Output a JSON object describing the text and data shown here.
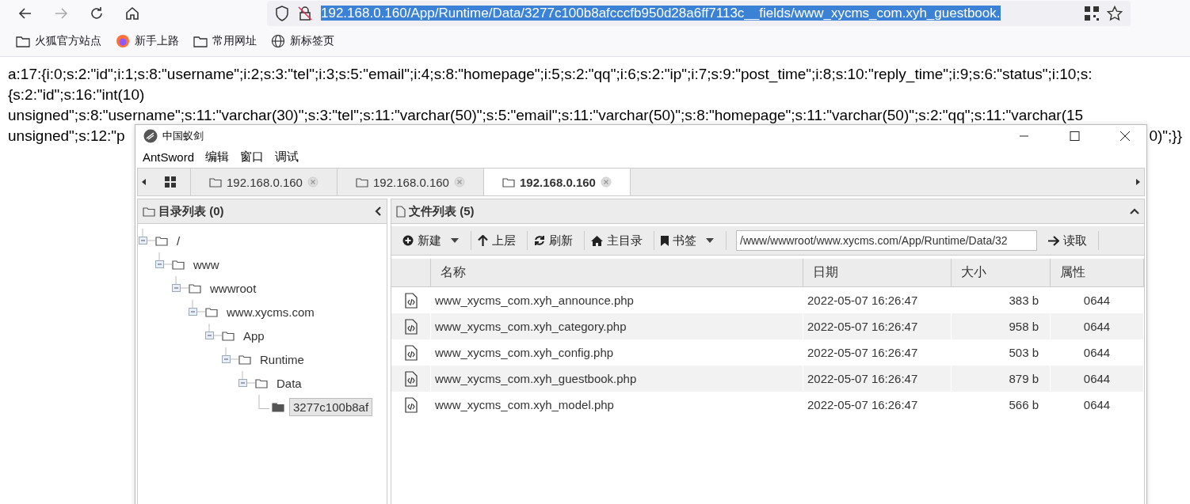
{
  "browser": {
    "url": {
      "text": "192.168.0.160/App/Runtime/Data/3277c100b8afcccfb950d28a6ff7113c__fields/www_xycms_com.xyh_guestbook.",
      "selected": true
    },
    "bookmarks": [
      {
        "label": "火狐官方站点",
        "kind": "folder"
      },
      {
        "label": "新手上路",
        "kind": "browser"
      },
      {
        "label": "常用网址",
        "kind": "folder"
      },
      {
        "label": "新标签页",
        "kind": "globe"
      }
    ]
  },
  "page_lines": [
    {
      "left": "a:17:{i:0;s:2:\"id\";i:1;s:8:\"username\";i:2;s:3:\"tel\";i:3;s:5:\"email\";i:4;s:8:\"homepage\";i:5;s:2:\"qq\";i:6;s:2:\"ip\";i:7;s:9:\"post_time\";i:8;s:10:\"reply_time\";i:9;s:6:\"status\";i:10;s:"
    },
    {
      "left": "{s:2:\"id\";s:16:\"int(10)"
    },
    {
      "left": "unsigned\";s:8:\"username\";s:11:\"varchar(30)\";s:3:\"tel\";s:11:\"varchar(50)\";s:5:\"email\";s:11:\"varchar(50)\";s:8:\"homepage\";s:11:\"varchar(50)\";s:2:\"qq\";s:11:\"varchar(15"
    },
    {
      "left": "unsigned\";s:12:\"p",
      "right": "0)\";}}"
    }
  ],
  "window": {
    "title": "中国蚁剑",
    "menu": [
      "AntSword",
      "编辑",
      "窗口",
      "调试"
    ],
    "tabs": [
      {
        "kind": "home",
        "selected": false
      },
      {
        "kind": "host",
        "label": "192.168.0.160",
        "selected": false
      },
      {
        "kind": "host",
        "label": "192.168.0.160",
        "selected": false
      },
      {
        "kind": "host",
        "label": "192.168.0.160",
        "selected": true
      }
    ],
    "dir_panel": {
      "title": "目录列表 (0)",
      "tree": [
        {
          "label": "/",
          "expanded": true,
          "selected": false,
          "children": [
            {
              "label": "www",
              "expanded": true,
              "selected": false,
              "children": [
                {
                  "label": "wwwroot",
                  "expanded": true,
                  "selected": false,
                  "children": [
                    {
                      "label": "www.xycms.com",
                      "expanded": true,
                      "selected": false,
                      "children": [
                        {
                          "label": "App",
                          "expanded": true,
                          "selected": false,
                          "children": [
                            {
                              "label": "Runtime",
                              "expanded": true,
                              "selected": false,
                              "children": [
                                {
                                  "label": "Data",
                                  "expanded": true,
                                  "selected": false,
                                  "children": [
                                    {
                                      "label": "3277c100b8af",
                                      "expanded": false,
                                      "selected": true
                                    }
                                  ]
                                }
                              ]
                            }
                          ]
                        }
                      ]
                    }
                  ]
                }
              ]
            }
          ]
        }
      ]
    },
    "file_panel": {
      "title": "文件列表 (5)",
      "toolbar": [
        {
          "label": "新建",
          "kind": "new",
          "dropdown": true
        },
        {
          "label": "上层",
          "kind": "up",
          "dropdown": false
        },
        {
          "label": "刷新",
          "kind": "refresh",
          "dropdown": false
        },
        {
          "label": "主目录",
          "kind": "home",
          "dropdown": false
        },
        {
          "label": "书签",
          "kind": "bookmark",
          "dropdown": true
        }
      ],
      "path": "/www/wwwroot/www.xycms.com/App/Runtime/Data/32",
      "read_button": "读取",
      "table": {
        "columns": [
          "名称",
          "日期",
          "大小",
          "属性"
        ],
        "rows": [
          [
            "www_xycms_com.xyh_announce.php",
            "2022-05-07 16:26:47",
            "383 b",
            "0644"
          ],
          [
            "www_xycms_com.xyh_category.php",
            "2022-05-07 16:26:47",
            "958 b",
            "0644"
          ],
          [
            "www_xycms_com.xyh_config.php",
            "2022-05-07 16:26:47",
            "503 b",
            "0644"
          ],
          [
            "www_xycms_com.xyh_guestbook.php",
            "2022-05-07 16:26:47",
            "879 b",
            "0644"
          ],
          [
            "www_xycms_com.xyh_model.php",
            "2022-05-07 16:26:47",
            "566 b",
            "0644"
          ]
        ]
      }
    }
  }
}
